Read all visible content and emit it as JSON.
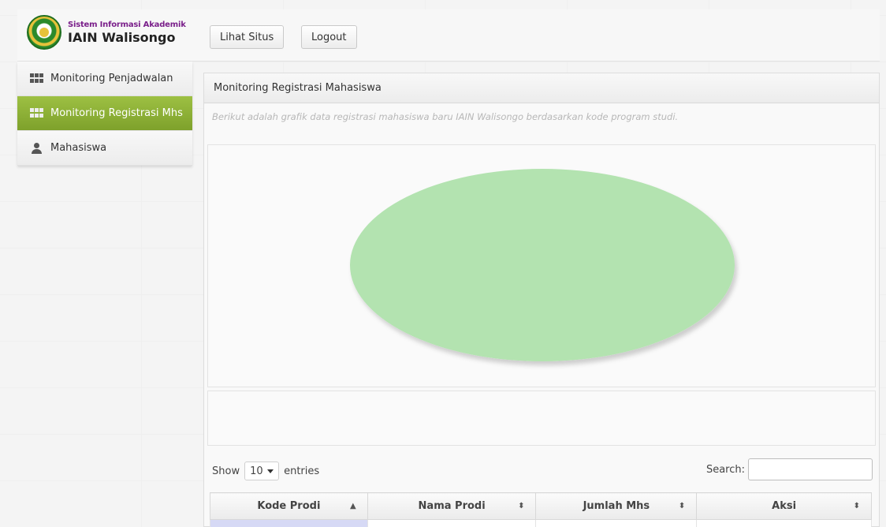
{
  "app": {
    "subtitle": "Sistem Informasi Akademik",
    "title": "IAIN Walisongo"
  },
  "header": {
    "lihat_situs": "Lihat Situs",
    "logout": "Logout"
  },
  "sidebar": {
    "items": [
      {
        "label": "Monitoring Penjadwalan",
        "icon": "grid-icon",
        "active": false
      },
      {
        "label": "Monitoring Registrasi Mhs",
        "icon": "grid-icon",
        "active": true
      },
      {
        "label": "Mahasiswa",
        "icon": "user-icon",
        "active": false
      }
    ]
  },
  "panel": {
    "title": "Monitoring Registrasi Mahasiswa",
    "description": "Berikut adalah grafik data registrasi mahasiswa baru IAIN Walisongo berdasarkan kode program studi."
  },
  "chart_data": {
    "type": "pie",
    "title": "",
    "slices": [
      {
        "label": "",
        "value": 100,
        "color": "#b3e3b0"
      }
    ]
  },
  "table": {
    "show_label": "Show",
    "entries_value": "10",
    "entries_label": "entries",
    "search_label": "Search:",
    "search_value": "",
    "columns": [
      "Kode Prodi",
      "Nama Prodi",
      "Jumlah Mhs",
      "Aksi"
    ]
  },
  "colors": {
    "accent": "#8bb034",
    "pie": "#b3e3b0"
  }
}
